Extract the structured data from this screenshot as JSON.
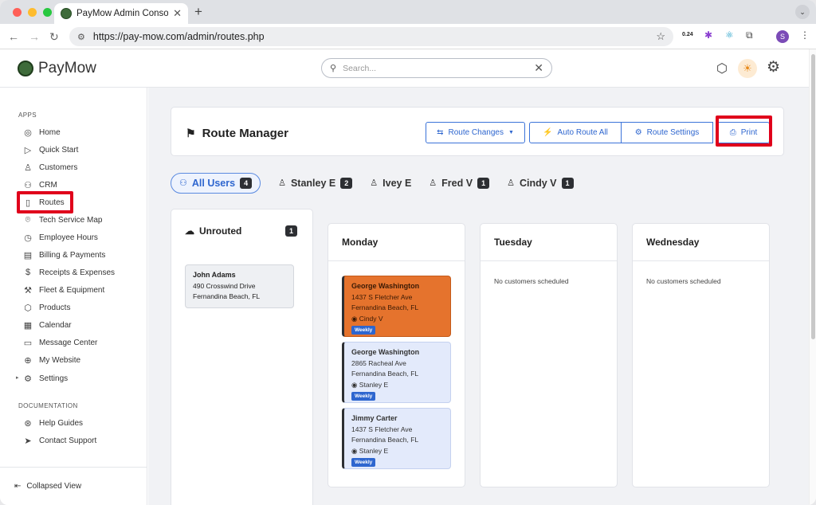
{
  "browser": {
    "tab_title": "PayMow Admin Console",
    "url": "https://pay-mow.com/admin/routes.php",
    "ext_counter": "0.24",
    "profile_initial": "S"
  },
  "header": {
    "brand": "PayMow",
    "search_placeholder": "Search..."
  },
  "sidebar": {
    "apps_heading": "APPS",
    "items": [
      {
        "label": "Home",
        "icon": "compass-icon"
      },
      {
        "label": "Quick Start",
        "icon": "play-icon"
      },
      {
        "label": "Customers",
        "icon": "person-icon"
      },
      {
        "label": "CRM",
        "icon": "people-icon"
      },
      {
        "label": "Routes",
        "icon": "map-icon"
      },
      {
        "label": "Tech Service Map",
        "icon": "pin-icon"
      },
      {
        "label": "Employee Hours",
        "icon": "clock-icon"
      },
      {
        "label": "Billing & Payments",
        "icon": "document-icon"
      },
      {
        "label": "Receipts & Expenses",
        "icon": "dollar-icon"
      },
      {
        "label": "Fleet & Equipment",
        "icon": "wrench-icon"
      },
      {
        "label": "Products",
        "icon": "box-icon"
      },
      {
        "label": "Calendar",
        "icon": "calendar-icon"
      },
      {
        "label": "Message Center",
        "icon": "chat-icon"
      },
      {
        "label": "My Website",
        "icon": "globe-icon"
      },
      {
        "label": "Settings",
        "icon": "gear-icon"
      }
    ],
    "docs_heading": "DOCUMENTATION",
    "doc_items": [
      {
        "label": "Help Guides",
        "icon": "lifebuoy-icon"
      },
      {
        "label": "Contact Support",
        "icon": "send-icon"
      }
    ],
    "collapse_label": "Collapsed View"
  },
  "route_manager": {
    "title": "Route Manager",
    "buttons": {
      "route_changes": "Route Changes",
      "auto_route": "Auto Route All",
      "route_settings": "Route Settings",
      "print": "Print"
    }
  },
  "user_tabs": [
    {
      "label": "All Users",
      "count": "4"
    },
    {
      "label": "Stanley E",
      "count": "2"
    },
    {
      "label": "Ivey E",
      "count": ""
    },
    {
      "label": "Fred V",
      "count": "1"
    },
    {
      "label": "Cindy V",
      "count": "1"
    }
  ],
  "unrouted": {
    "title": "Unrouted",
    "count": "1",
    "card": {
      "name": "John Adams",
      "line1": "490 Crosswind Drive",
      "line2": "Fernandina Beach, FL"
    }
  },
  "days": [
    {
      "name": "Monday",
      "cards": [
        {
          "name": "George Washington",
          "line1": "1437 S Fletcher Ave",
          "line2": "Fernandina Beach, FL",
          "tech": "Cindy V",
          "tag": "Weekly",
          "style": "orange"
        },
        {
          "name": "George Washington",
          "line1": "2865 Racheal Ave",
          "line2": "Fernandina Beach, FL",
          "tech": "Stanley E",
          "tag": "Weekly",
          "style": "blue"
        },
        {
          "name": "Jimmy Carter",
          "line1": "1437 S Fletcher Ave",
          "line2": "Fernandina Beach, FL",
          "tech": "Stanley E",
          "tag": "Weekly",
          "style": "blue"
        }
      ]
    },
    {
      "name": "Tuesday",
      "empty": "No customers scheduled"
    },
    {
      "name": "Wednesday",
      "empty": "No customers scheduled"
    }
  ],
  "colors": {
    "accent": "#2e66cf",
    "highlight": "#e0001b",
    "orange_card": "#e5732d",
    "blue_card": "#e3eafb"
  }
}
